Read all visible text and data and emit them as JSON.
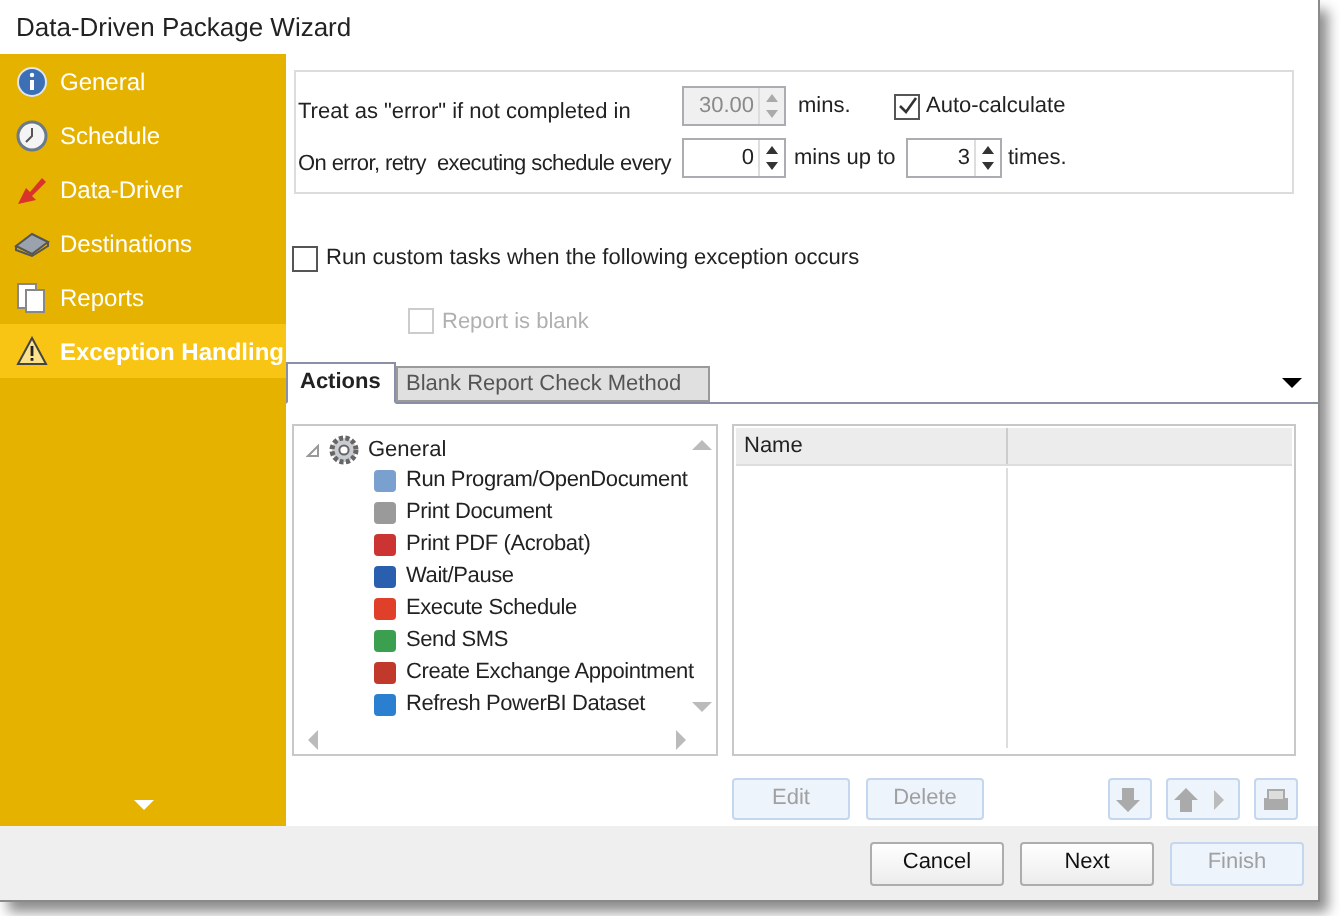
{
  "window": {
    "title": "Data-Driven Package Wizard"
  },
  "sidebar": {
    "items": [
      {
        "label": "General",
        "selected": false
      },
      {
        "label": "Schedule",
        "selected": false
      },
      {
        "label": "Data-Driver",
        "selected": false
      },
      {
        "label": "Destinations",
        "selected": false
      },
      {
        "label": "Reports",
        "selected": false
      },
      {
        "label": "Exception Handling",
        "selected": true
      }
    ]
  },
  "timeout": {
    "label": "Treat as \"error\" if not completed in",
    "value": "30.00",
    "disabled": true,
    "unit": "mins.",
    "auto_calculate": {
      "label": "Auto-calculate",
      "checked": true
    }
  },
  "retry": {
    "label": "On error, retry  executing schedule every",
    "interval": "0",
    "interval_unit": "mins up to",
    "count": "3",
    "count_unit": "times."
  },
  "custom_tasks": {
    "label": "Run custom tasks when the following exception occurs",
    "checked": false
  },
  "report_blank": {
    "label": "Report is blank",
    "checked": false,
    "disabled": true
  },
  "tabs": [
    {
      "label": "Actions",
      "selected": true
    },
    {
      "label": "Blank Report Check Method",
      "selected": false
    }
  ],
  "action_tree": [
    {
      "label": "General",
      "expanded": true,
      "children": [
        {
          "label": "Run Program/OpenDocument"
        },
        {
          "label": "Print Document"
        },
        {
          "label": "Print PDF (Acrobat)"
        },
        {
          "label": "Wait/Pause"
        },
        {
          "label": "Execute Schedule"
        },
        {
          "label": "Send SMS"
        },
        {
          "label": "Create Exchange Appointment"
        },
        {
          "label": "Refresh PowerBI Dataset"
        }
      ]
    }
  ],
  "task_list": {
    "columns": [
      "Name"
    ]
  },
  "list_buttons": [
    {
      "label": "Edit",
      "disabled": true
    },
    {
      "label": "Delete",
      "disabled": true
    }
  ],
  "footer_buttons": [
    {
      "label": "Cancel",
      "disabled": false
    },
    {
      "label": "Next",
      "disabled": false
    },
    {
      "label": "Finish",
      "disabled": true
    }
  ]
}
